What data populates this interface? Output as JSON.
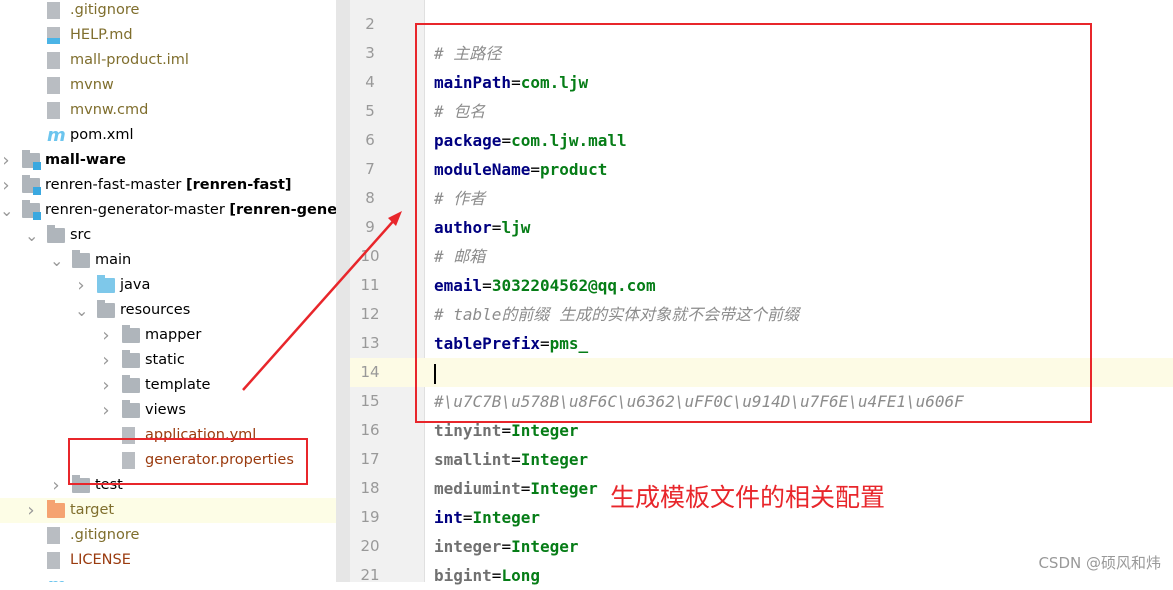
{
  "tree": [
    {
      "label": ".gitignore",
      "icon": "gitignore-file-icon",
      "cls": "olive",
      "indent": 2
    },
    {
      "label": "HELP.md",
      "icon": "markdown-file-icon",
      "cls": "olive",
      "indent": 2
    },
    {
      "label": "mall-product.iml",
      "icon": "iml-file-icon",
      "cls": "olive",
      "indent": 2
    },
    {
      "label": "mvnw",
      "icon": "shell-script-icon",
      "cls": "olive",
      "indent": 2
    },
    {
      "label": "mvnw.cmd",
      "icon": "text-file-icon",
      "cls": "olive",
      "indent": 2
    },
    {
      "label": "pom.xml",
      "icon": "maven-icon",
      "cls": "",
      "indent": 2
    },
    {
      "label": "mall-ware",
      "icon": "module-folder-icon",
      "cls": "bold",
      "indent": 1,
      "chev": "right"
    },
    {
      "label": "renren-fast-master ",
      "suffix": "[renren-fast]",
      "icon": "module-folder-icon",
      "cls": "",
      "indent": 1,
      "chev": "right"
    },
    {
      "label": "renren-generator-master ",
      "suffix": "[renren-generator]",
      "icon": "module-folder-icon",
      "cls": "",
      "indent": 1,
      "chev": "down"
    },
    {
      "label": "src",
      "icon": "folder-icon",
      "cls": "",
      "indent": 2,
      "chev": "down"
    },
    {
      "label": "main",
      "icon": "folder-icon",
      "cls": "",
      "indent": 3,
      "chev": "down"
    },
    {
      "label": "java",
      "icon": "source-folder-icon",
      "cls": "",
      "indent": 4,
      "chev": "right"
    },
    {
      "label": "resources",
      "icon": "resources-folder-icon",
      "cls": "",
      "indent": 4,
      "chev": "down"
    },
    {
      "label": "mapper",
      "icon": "folder-icon",
      "cls": "",
      "indent": 5,
      "chev": "right"
    },
    {
      "label": "static",
      "icon": "folder-icon",
      "cls": "",
      "indent": 5,
      "chev": "right"
    },
    {
      "label": "template",
      "icon": "folder-icon",
      "cls": "",
      "indent": 5,
      "chev": "right"
    },
    {
      "label": "views",
      "icon": "folder-icon",
      "cls": "",
      "indent": 5,
      "chev": "right"
    },
    {
      "label": "application.yml",
      "icon": "spring-yml-icon",
      "cls": "brown",
      "indent": 5
    },
    {
      "label": "generator.properties",
      "icon": "properties-file-icon",
      "cls": "brown",
      "indent": 5
    },
    {
      "label": "test",
      "icon": "folder-icon",
      "cls": "",
      "indent": 3,
      "chev": "right"
    },
    {
      "label": "target",
      "icon": "excluded-folder-icon",
      "cls": "olive",
      "indent": 2,
      "chev": "right",
      "hl": true
    },
    {
      "label": ".gitignore",
      "icon": "gitignore-file-icon",
      "cls": "olive",
      "indent": 2
    },
    {
      "label": "LICENSE",
      "icon": "text-file-icon",
      "cls": "brown",
      "indent": 2
    },
    {
      "label": "",
      "icon": "maven-icon",
      "cls": "",
      "indent": 2
    }
  ],
  "code": [
    {
      "n": "2",
      "parts": []
    },
    {
      "n": "3",
      "parts": [
        [
          "cm",
          "# 主路径"
        ]
      ]
    },
    {
      "n": "4",
      "parts": [
        [
          "k",
          "mainPath"
        ],
        [
          "eq",
          "="
        ],
        [
          "v",
          "com.ljw"
        ]
      ]
    },
    {
      "n": "5",
      "parts": [
        [
          "cm",
          "# 包名"
        ]
      ]
    },
    {
      "n": "6",
      "parts": [
        [
          "k",
          "package"
        ],
        [
          "eq",
          "="
        ],
        [
          "v",
          "com.ljw.mall"
        ]
      ]
    },
    {
      "n": "7",
      "parts": [
        [
          "k",
          "moduleName"
        ],
        [
          "eq",
          "="
        ],
        [
          "v",
          "product"
        ]
      ]
    },
    {
      "n": "8",
      "parts": [
        [
          "cm",
          "# 作者"
        ]
      ]
    },
    {
      "n": "9",
      "parts": [
        [
          "k",
          "author"
        ],
        [
          "eq",
          "="
        ],
        [
          "v",
          "ljw"
        ]
      ]
    },
    {
      "n": "10",
      "parts": [
        [
          "cm",
          "# 邮箱"
        ]
      ]
    },
    {
      "n": "11",
      "parts": [
        [
          "k",
          "email"
        ],
        [
          "eq",
          "="
        ],
        [
          "v",
          "3032204562@qq.com"
        ]
      ]
    },
    {
      "n": "12",
      "parts": [
        [
          "cm",
          "# table的前缀 生成的实体对象就不会带这个前缀"
        ]
      ]
    },
    {
      "n": "13",
      "parts": [
        [
          "k",
          "tablePrefix"
        ],
        [
          "eq",
          "="
        ],
        [
          "v",
          "pms_"
        ]
      ]
    },
    {
      "n": "14",
      "parts": [],
      "current": true
    },
    {
      "n": "15",
      "parts": [
        [
          "cm",
          "#\\u7C7B\\u578B\\u8F6C\\u6362\\uFF0C\\u914D\\u7F6E\\u4FE1\\u606F"
        ]
      ]
    },
    {
      "n": "16",
      "parts": [
        [
          "kg",
          "tinyint"
        ],
        [
          "eq",
          "="
        ],
        [
          "v",
          "Integer"
        ]
      ]
    },
    {
      "n": "17",
      "parts": [
        [
          "kg",
          "smallint"
        ],
        [
          "eq",
          "="
        ],
        [
          "v",
          "Integer"
        ]
      ]
    },
    {
      "n": "18",
      "parts": [
        [
          "kg",
          "mediumint"
        ],
        [
          "eq",
          "="
        ],
        [
          "v",
          "Integer"
        ]
      ]
    },
    {
      "n": "19",
      "parts": [
        [
          "k",
          "int"
        ],
        [
          "eq",
          "="
        ],
        [
          "v",
          "Integer"
        ]
      ]
    },
    {
      "n": "20",
      "parts": [
        [
          "kg",
          "integer"
        ],
        [
          "eq",
          "="
        ],
        [
          "v",
          "Integer"
        ]
      ]
    },
    {
      "n": "21",
      "parts": [
        [
          "kg",
          "bigint"
        ],
        [
          "eq",
          "="
        ],
        [
          "v",
          "Long"
        ]
      ]
    }
  ],
  "annotation": {
    "note": "生成模板文件的相关配置",
    "color": "#e8262b"
  },
  "watermark": "CSDN @硕风和炜"
}
